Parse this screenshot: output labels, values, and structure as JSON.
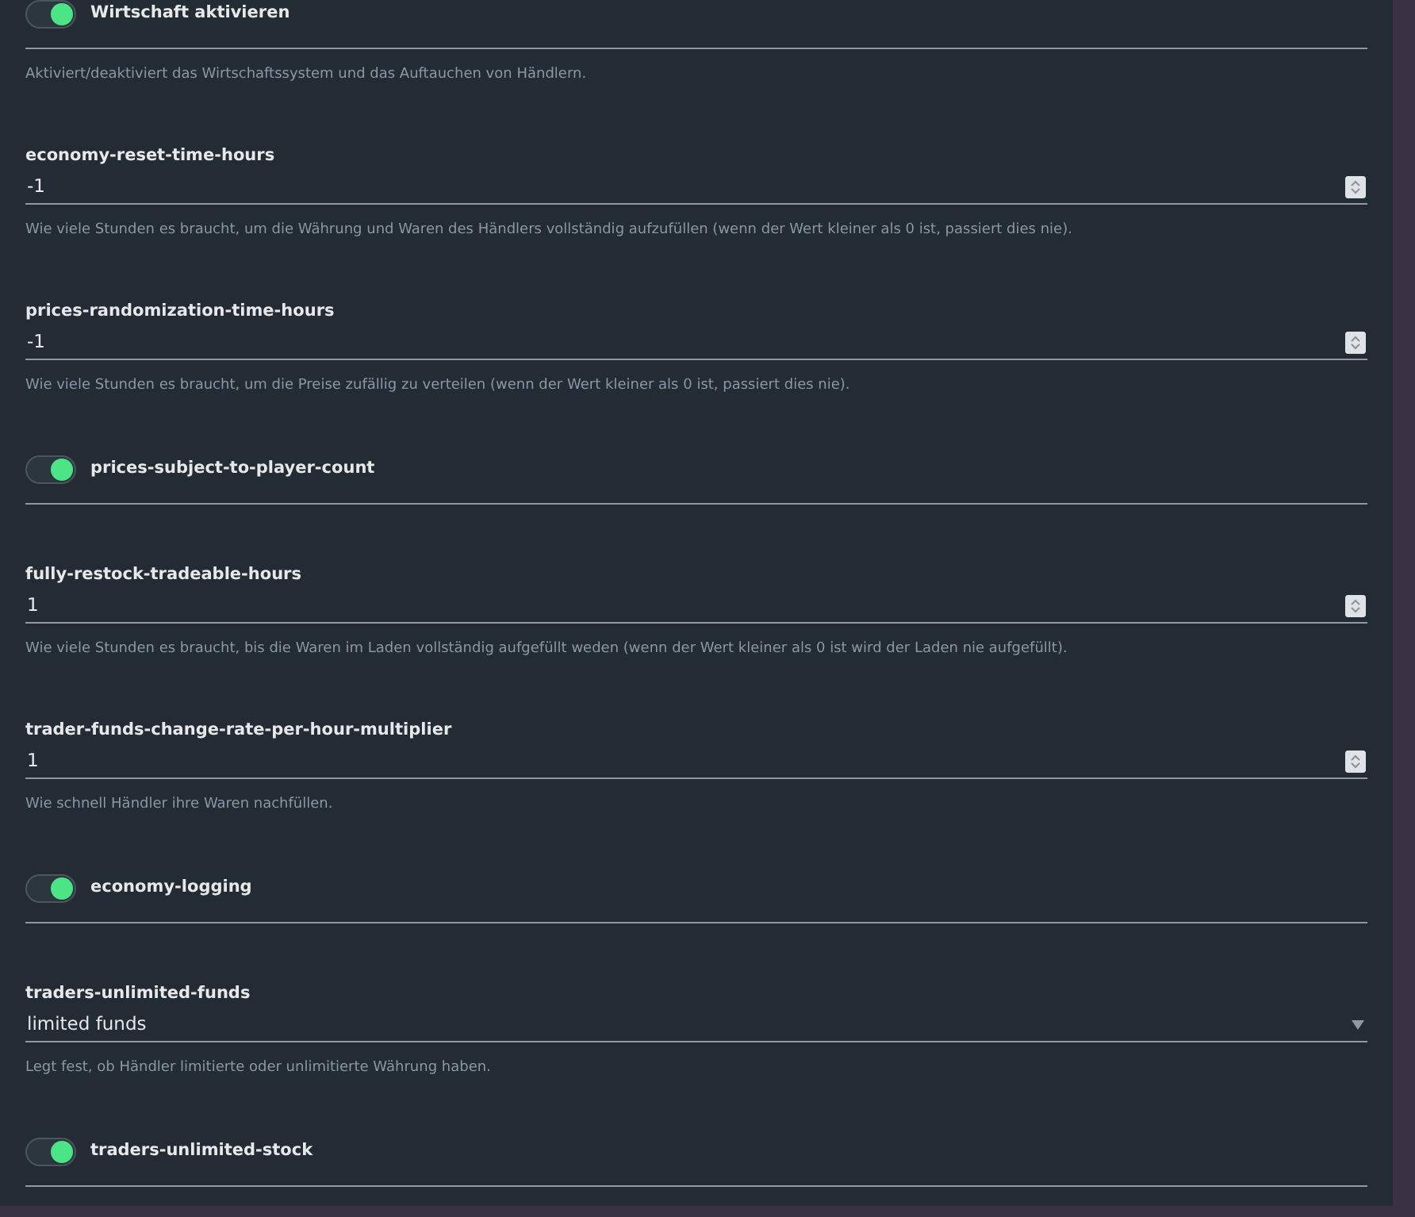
{
  "settings": [
    {
      "kind": "toggle",
      "label": "Wirtschaft aktivieren",
      "on": true,
      "help": "Aktiviert/deaktiviert das Wirtschaftssystem und das Auftauchen von Händlern."
    },
    {
      "kind": "number",
      "label": "economy-reset-time-hours",
      "value": "-1",
      "help": "Wie viele Stunden es braucht, um die Währung und Waren des Händlers vollständig aufzufüllen (wenn der Wert kleiner als 0 ist, passiert dies nie)."
    },
    {
      "kind": "number",
      "label": "prices-randomization-time-hours",
      "value": "-1",
      "help": "Wie viele Stunden es braucht, um die Preise zufällig zu verteilen (wenn der Wert kleiner als 0 ist, passiert dies nie)."
    },
    {
      "kind": "toggle",
      "label": "prices-subject-to-player-count",
      "on": true
    },
    {
      "kind": "number",
      "label": "fully-restock-tradeable-hours",
      "value": "1",
      "help": "Wie viele Stunden es braucht, bis die Waren im Laden vollständig aufgefüllt weden (wenn der Wert kleiner als 0 ist wird der Laden nie aufgefüllt)."
    },
    {
      "kind": "number",
      "label": "trader-funds-change-rate-per-hour-multiplier",
      "value": "1",
      "help": "Wie schnell Händler ihre Waren nachfüllen."
    },
    {
      "kind": "toggle",
      "label": "economy-logging",
      "on": true
    },
    {
      "kind": "select",
      "label": "traders-unlimited-funds",
      "value": "limited funds",
      "help": "Legt fest, ob Händler limitierte oder unlimitierte Währung haben."
    },
    {
      "kind": "toggle",
      "label": "traders-unlimited-stock",
      "on": true
    }
  ]
}
